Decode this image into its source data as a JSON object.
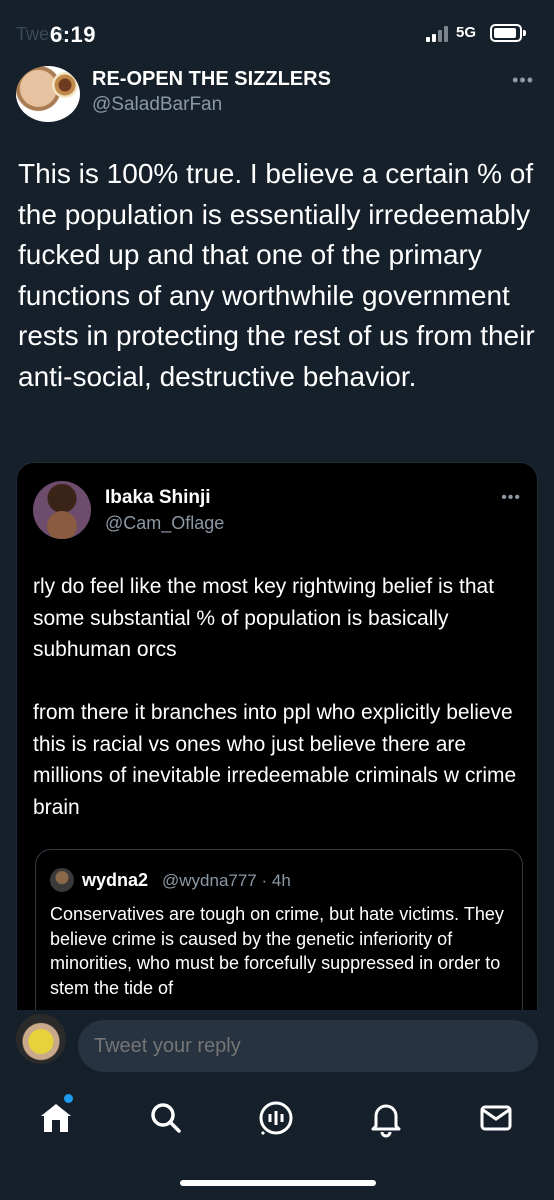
{
  "status_bar": {
    "time": "6:19",
    "network": "5G",
    "faded_header": "Tweet"
  },
  "tweet": {
    "display_name": "RE-OPEN THE SIZZLERS",
    "handle": "@SaladBarFan",
    "more": "•••",
    "text": "This is 100% true. I believe a certain % of the population is essentially irredeemably fucked up and that one of the primary functions of any worthwhile government rests in protecting the rest of us from their anti-social, destructive behavior."
  },
  "quoted_tweet": {
    "display_name": "Ibaka Shinji",
    "handle": "@Cam_Oflage",
    "more": "•••",
    "paragraph1": "rly do feel like the most key rightwing belief is that some substantial % of population is basically subhuman orcs",
    "paragraph2": "from there it branches into ppl who explicitly believe this is racial vs ones who just believe there are millions of inevitable irredeemable criminals w crime brain"
  },
  "nested_quote": {
    "display_name": "wydna2",
    "handle_time": "@wydna777 · 4h",
    "text": "Conservatives are tough on crime, but hate victims. They believe crime is caused by the genetic inferiority of minorities, who must be forcefully suppressed in order to stem the tide of"
  },
  "reply": {
    "placeholder": "Tweet your reply"
  },
  "nav": {
    "items": [
      "home-icon",
      "search-icon",
      "spaces-icon",
      "notifications-icon",
      "messages-icon"
    ],
    "accent": "#1d9bf0"
  }
}
